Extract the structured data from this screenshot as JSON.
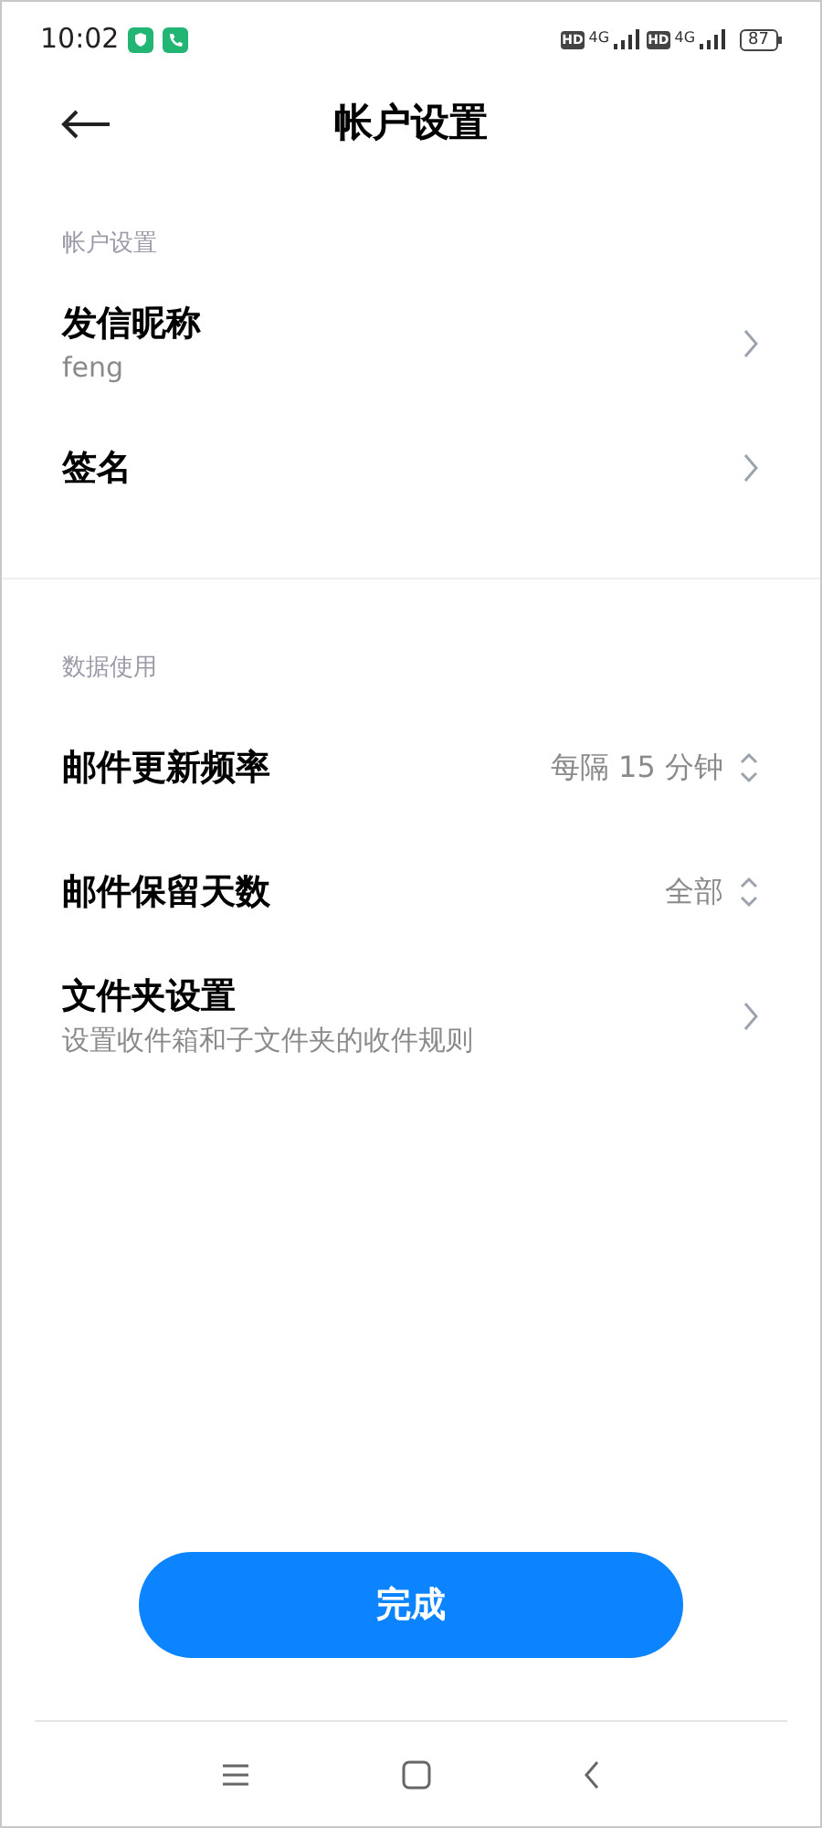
{
  "status_bar": {
    "time": "10:02",
    "sim_badges": [
      {
        "hd": "HD",
        "network": "4G"
      },
      {
        "hd": "HD",
        "network": "4G"
      }
    ],
    "battery": "87"
  },
  "header": {
    "title": "帐户设置"
  },
  "sections": [
    {
      "title": "帐户设置",
      "items": [
        {
          "kind": "link",
          "label": "发信昵称",
          "subtitle": "feng"
        },
        {
          "kind": "link",
          "label": "签名"
        }
      ]
    },
    {
      "title": "数据使用",
      "items": [
        {
          "kind": "select",
          "label": "邮件更新频率",
          "value": "每隔 15 分钟"
        },
        {
          "kind": "select",
          "label": "邮件保留天数",
          "value": "全部"
        },
        {
          "kind": "link",
          "label": "文件夹设置",
          "subtitle": "设置收件箱和子文件夹的收件规则"
        }
      ]
    }
  ],
  "done_button": "完成"
}
